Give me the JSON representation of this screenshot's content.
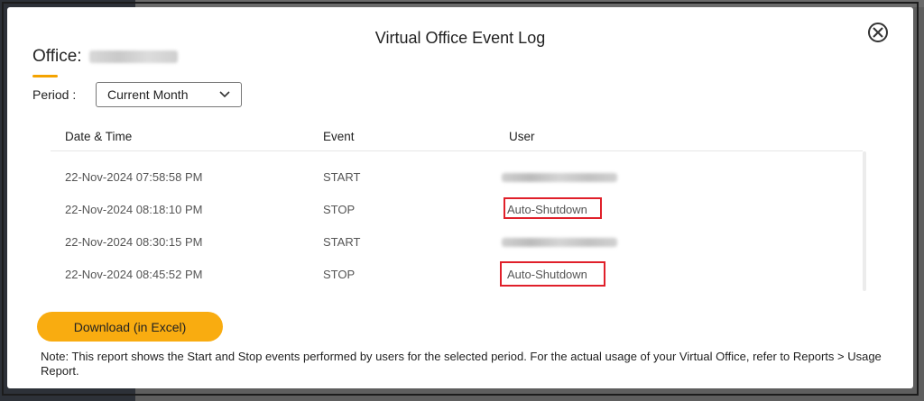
{
  "modal": {
    "title": "Virtual Office Event Log",
    "office_label": "Office:",
    "period_label": "Period :",
    "period_selected": "Current Month",
    "download_label": "Download (in Excel)",
    "note": "Note: This report shows the Start and Stop events performed by users for the selected period. For the actual usage of your Virtual Office, refer to Reports > Usage Report."
  },
  "table": {
    "headers": [
      "Date & Time",
      "Event",
      "User"
    ],
    "rows": [
      {
        "datetime": "22-Nov-2024 07:58:58 PM",
        "event": "START",
        "user": ""
      },
      {
        "datetime": "22-Nov-2024 08:18:10 PM",
        "event": "STOP",
        "user": "Auto-Shutdown"
      },
      {
        "datetime": "22-Nov-2024 08:30:15 PM",
        "event": "START",
        "user": ""
      },
      {
        "datetime": "22-Nov-2024 08:45:52 PM",
        "event": "STOP",
        "user": "Auto-Shutdown"
      }
    ]
  },
  "colors": {
    "accent": "#f9ac10",
    "highlight": "#e0202a"
  },
  "icons": {
    "close": "close-circle-icon",
    "dropdown": "chevron-down-icon"
  }
}
